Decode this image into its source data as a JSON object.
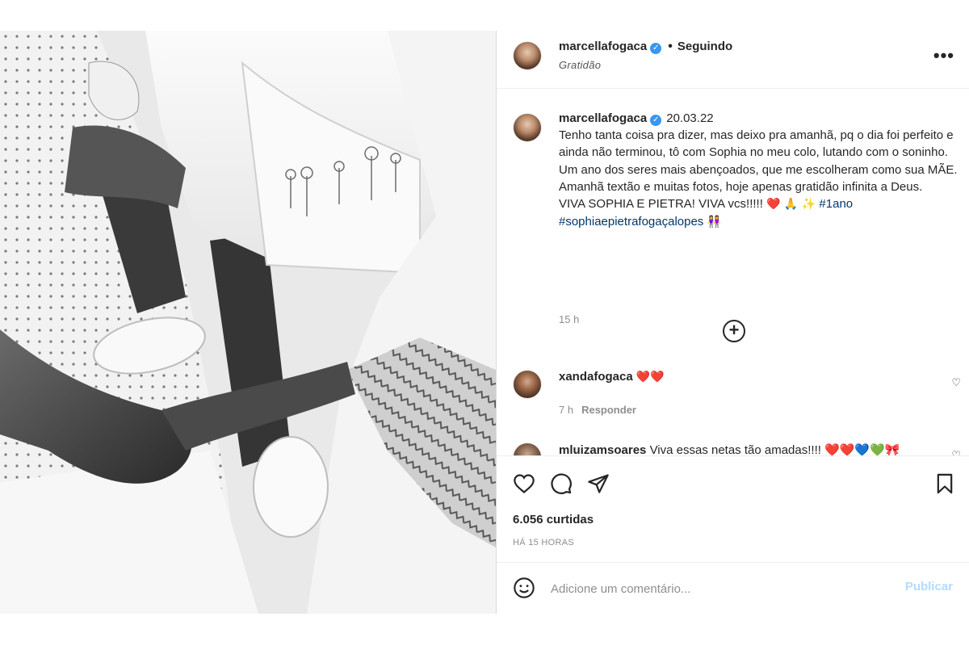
{
  "header": {
    "username": "marcellafogaca",
    "separator": "•",
    "follow_status": "Seguindo",
    "location": "Gratidão",
    "more_label": "•••"
  },
  "caption": {
    "username": "marcellafogaca",
    "date": "20.03.22",
    "line1": "Tenho tanta coisa pra dizer, mas deixo pra amanhã, pq o dia foi perfeito e ainda não terminou, tô com Sophia no meu colo, lutando com o soninho.",
    "line2": "Um ano dos seres mais abençoados, que me escolheram como sua MÃE.",
    "line3": "Amanhã textão e muitas fotos, hoje apenas gratidão infinita a Deus.",
    "line4_text": "VIVA SOPHIA E PIETRA! VIVA vcs!!!!!",
    "line4_emoji": "❤️ 🙏 ✨",
    "hashtag1": "#1ano",
    "hashtag2": "#sophiaepietrafogaçalopes",
    "hashtag2_emoji": "👭",
    "time_ago": "15 h"
  },
  "comments": [
    {
      "username": "xandafogaca",
      "text": "❤️❤️",
      "time": "7 h",
      "reply_label": "Responder"
    },
    {
      "username": "mluizamsoares",
      "text": "Viva essas netas tão amadas!!!! ❤️❤️💙💚🎀",
      "time": "",
      "reply_label": ""
    }
  ],
  "icons": {
    "like": "heart-icon",
    "comment": "comment-icon",
    "share": "share-icon",
    "save": "bookmark-icon",
    "load_more": "plus-circle-icon",
    "emoji": "smiley-icon"
  },
  "stats": {
    "likes": "6.056 curtidas",
    "posted": "HÁ 15 HORAS"
  },
  "add_comment": {
    "placeholder": "Adicione um comentário...",
    "publish_label": "Publicar"
  },
  "colors": {
    "verified": "#3897f0",
    "link": "#00376b",
    "publish_disabled": "#b3dbff",
    "muted": "#8e8e8e"
  }
}
